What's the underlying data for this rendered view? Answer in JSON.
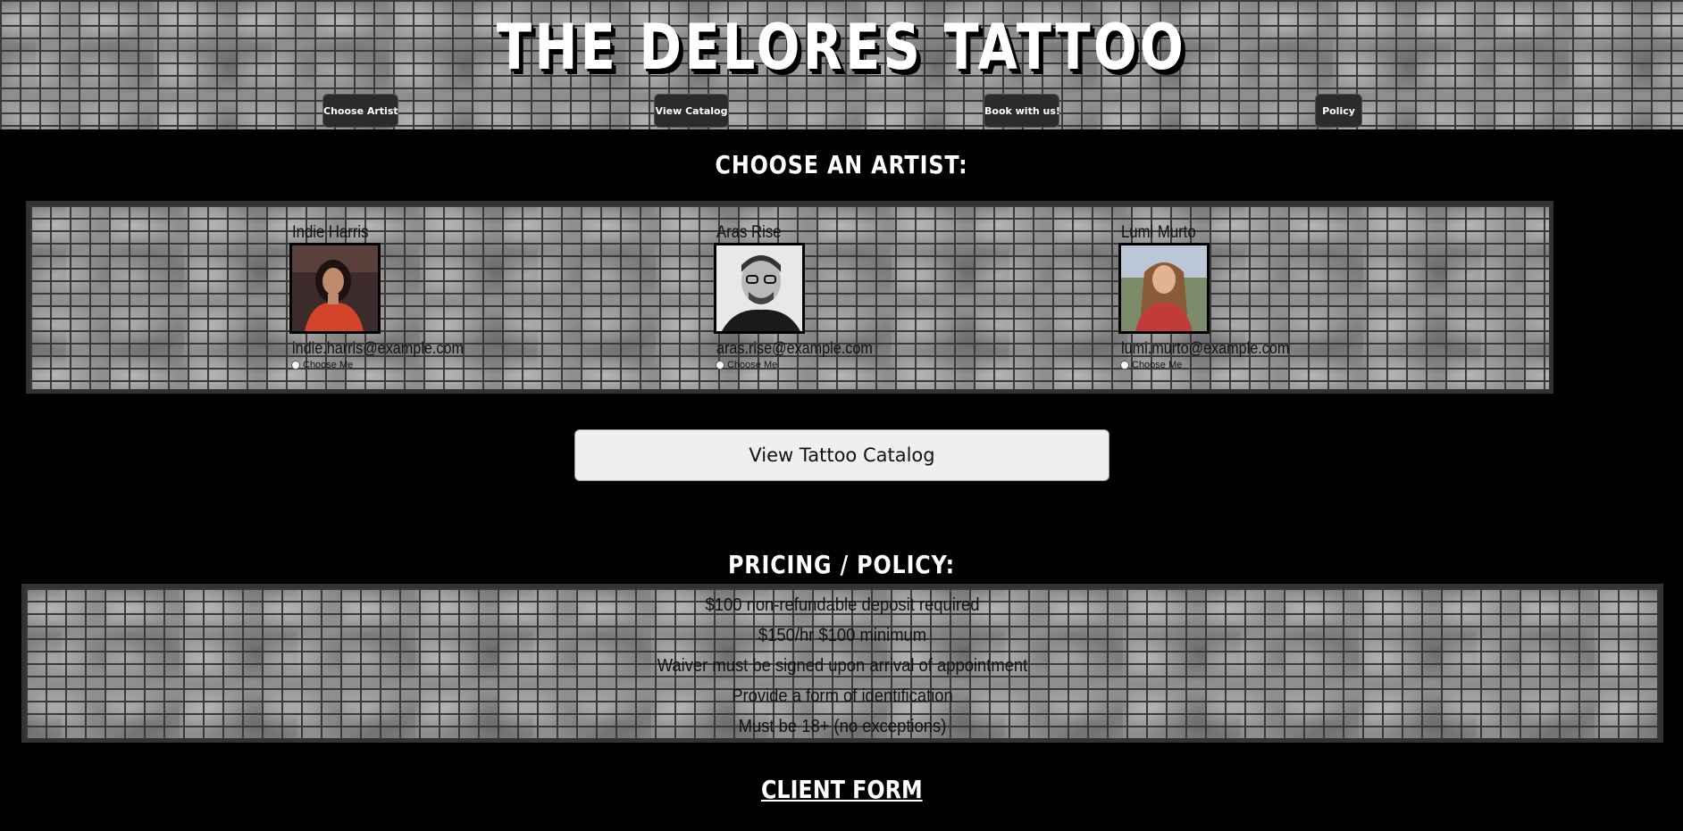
{
  "header": {
    "title": "THE DELORES TATTOO",
    "nav": [
      {
        "label": "Choose Artist"
      },
      {
        "label": "View Catalog"
      },
      {
        "label": "Book with us!"
      },
      {
        "label": "Policy"
      }
    ]
  },
  "artists_section": {
    "heading": "CHOOSE AN ARTIST:",
    "artists": [
      {
        "name": "Indie Harris",
        "email": "indie.harris@example.com",
        "choose_label": "Choose Me",
        "photo_colors": {
          "bg": "#3d2a2a",
          "accent": "#d2452a"
        }
      },
      {
        "name": "Aras Rise",
        "email": "aras.rise@example.com",
        "choose_label": "Choose Me",
        "photo_colors": {
          "bg": "#e8e8e8",
          "accent": "#1a1a1a"
        }
      },
      {
        "name": "Lumi Murto",
        "email": "lumi.murto@example.com",
        "choose_label": "Choose Me",
        "photo_colors": {
          "bg": "#7c8b6a",
          "accent": "#c23b3b"
        }
      }
    ]
  },
  "catalog_button": {
    "label": "View Tattoo Catalog"
  },
  "policy_section": {
    "heading": "PRICING / POLICY:",
    "lines": [
      "$100 non-refundable deposit required",
      "$150/hr $100 minimum",
      "Waiver must be signed upon arrival of appointment",
      "Provide a form of identification",
      "Must be 18+ (no exceptions)"
    ]
  },
  "client_form": {
    "heading": "CLIENT FORM"
  }
}
